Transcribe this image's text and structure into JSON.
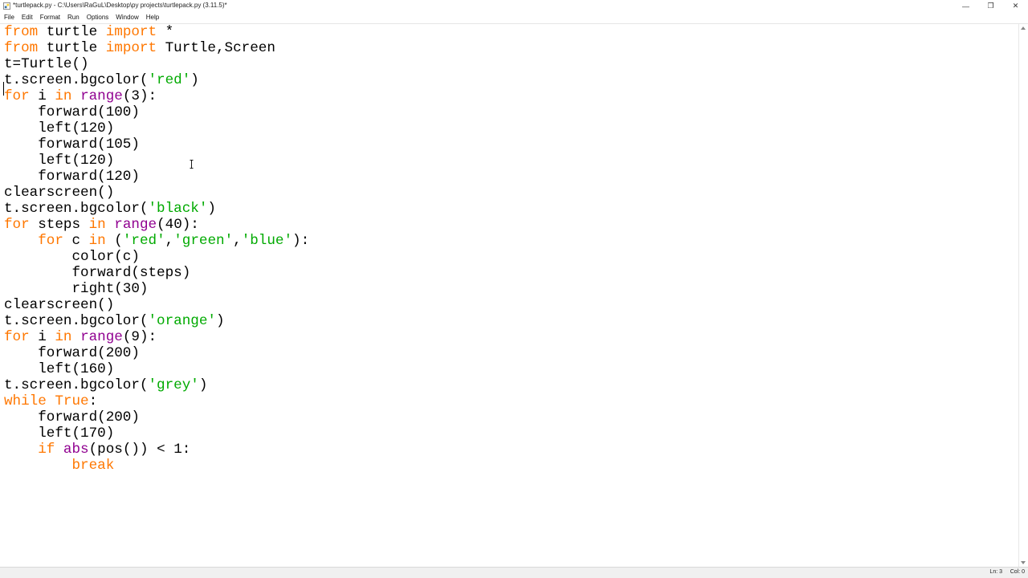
{
  "window": {
    "title": "*turtlepack.py - C:\\Users\\RaGuL\\Desktop\\py projects\\turtlepack.py (3.11.5)*",
    "controls": {
      "minimize": "—",
      "maximize": "❐",
      "close": "✕"
    }
  },
  "menu": [
    "File",
    "Edit",
    "Format",
    "Run",
    "Options",
    "Window",
    "Help"
  ],
  "editor": {
    "syntax_colors": {
      "keyword": "#ff7700",
      "builtin": "#900090",
      "string": "#00aa00",
      "default": "#000000"
    },
    "lines": [
      [
        {
          "t": "from",
          "c": "kw"
        },
        {
          "t": " turtle ",
          "c": ""
        },
        {
          "t": "import",
          "c": "kw"
        },
        {
          "t": " *",
          "c": ""
        }
      ],
      [
        {
          "t": "from",
          "c": "kw"
        },
        {
          "t": " turtle ",
          "c": ""
        },
        {
          "t": "import",
          "c": "kw"
        },
        {
          "t": " Turtle,Screen",
          "c": ""
        }
      ],
      [
        {
          "t": "t=Turtle()",
          "c": ""
        }
      ],
      [
        {
          "t": "t.screen.bgcolor(",
          "c": ""
        },
        {
          "t": "'red'",
          "c": "str"
        },
        {
          "t": ")",
          "c": ""
        }
      ],
      [
        {
          "t": "for",
          "c": "kw"
        },
        {
          "t": " i ",
          "c": ""
        },
        {
          "t": "in",
          "c": "kw"
        },
        {
          "t": " ",
          "c": ""
        },
        {
          "t": "range",
          "c": "bi"
        },
        {
          "t": "(3):",
          "c": ""
        }
      ],
      [
        {
          "t": "    forward(100)",
          "c": ""
        }
      ],
      [
        {
          "t": "    left(120)",
          "c": ""
        }
      ],
      [
        {
          "t": "    forward(105)",
          "c": ""
        }
      ],
      [
        {
          "t": "    left(120)",
          "c": ""
        }
      ],
      [
        {
          "t": "    forward(120)",
          "c": ""
        }
      ],
      [
        {
          "t": "clearscreen()",
          "c": ""
        }
      ],
      [
        {
          "t": "t.screen.bgcolor(",
          "c": ""
        },
        {
          "t": "'black'",
          "c": "str"
        },
        {
          "t": ")",
          "c": ""
        }
      ],
      [
        {
          "t": "for",
          "c": "kw"
        },
        {
          "t": " steps ",
          "c": ""
        },
        {
          "t": "in",
          "c": "kw"
        },
        {
          "t": " ",
          "c": ""
        },
        {
          "t": "range",
          "c": "bi"
        },
        {
          "t": "(40):",
          "c": ""
        }
      ],
      [
        {
          "t": "    ",
          "c": ""
        },
        {
          "t": "for",
          "c": "kw"
        },
        {
          "t": " c ",
          "c": ""
        },
        {
          "t": "in",
          "c": "kw"
        },
        {
          "t": " (",
          "c": ""
        },
        {
          "t": "'red'",
          "c": "str"
        },
        {
          "t": ",",
          "c": ""
        },
        {
          "t": "'green'",
          "c": "str"
        },
        {
          "t": ",",
          "c": ""
        },
        {
          "t": "'blue'",
          "c": "str"
        },
        {
          "t": "):",
          "c": ""
        }
      ],
      [
        {
          "t": "        color(c)",
          "c": ""
        }
      ],
      [
        {
          "t": "        forward(steps)",
          "c": ""
        }
      ],
      [
        {
          "t": "        right(30)",
          "c": ""
        }
      ],
      [
        {
          "t": "clearscreen()",
          "c": ""
        }
      ],
      [
        {
          "t": "t.screen.bgcolor(",
          "c": ""
        },
        {
          "t": "'orange'",
          "c": "str"
        },
        {
          "t": ")",
          "c": ""
        }
      ],
      [
        {
          "t": "for",
          "c": "kw"
        },
        {
          "t": " i ",
          "c": ""
        },
        {
          "t": "in",
          "c": "kw"
        },
        {
          "t": " ",
          "c": ""
        },
        {
          "t": "range",
          "c": "bi"
        },
        {
          "t": "(9):",
          "c": ""
        }
      ],
      [
        {
          "t": "    forward(200)",
          "c": ""
        }
      ],
      [
        {
          "t": "    left(160)",
          "c": ""
        }
      ],
      [
        {
          "t": "t.screen.bgcolor(",
          "c": ""
        },
        {
          "t": "'grey'",
          "c": "str"
        },
        {
          "t": ")",
          "c": ""
        }
      ],
      [
        {
          "t": "while",
          "c": "kw"
        },
        {
          "t": " ",
          "c": ""
        },
        {
          "t": "True",
          "c": "kw"
        },
        {
          "t": ":",
          "c": ""
        }
      ],
      [
        {
          "t": "    forward(200)",
          "c": ""
        }
      ],
      [
        {
          "t": "    left(170)",
          "c": ""
        }
      ],
      [
        {
          "t": "    ",
          "c": ""
        },
        {
          "t": "if",
          "c": "kw"
        },
        {
          "t": " ",
          "c": ""
        },
        {
          "t": "abs",
          "c": "bi"
        },
        {
          "t": "(pos()) < 1:",
          "c": ""
        }
      ],
      [
        {
          "t": "        ",
          "c": ""
        },
        {
          "t": "break",
          "c": "kw"
        }
      ]
    ]
  },
  "status": {
    "line": "Ln: 3",
    "col": "Col: 0"
  }
}
